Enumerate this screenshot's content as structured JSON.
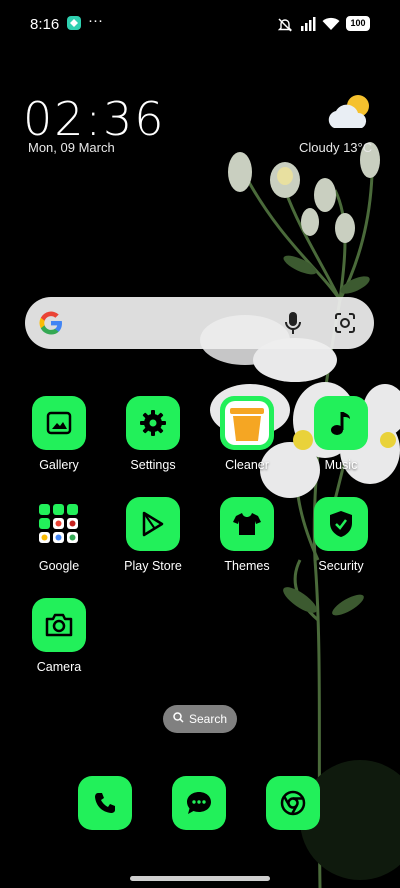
{
  "status_bar": {
    "time": "8:16",
    "overflow": "···",
    "battery": "100",
    "icons": [
      "app-notification-icon",
      "mute-icon",
      "signal-icon",
      "wifi-icon",
      "battery-icon"
    ]
  },
  "clock_widget": {
    "time": "02:36",
    "date": "Mon, 09 March",
    "weather": "Cloudy  13°C",
    "weather_icon": "cloudy-sun-icon"
  },
  "search": {
    "label": "Search",
    "icons": [
      "google-icon",
      "mic-icon",
      "lens-icon"
    ]
  },
  "apps": [
    {
      "label": "Gallery",
      "icon": "gallery-icon"
    },
    {
      "label": "Settings",
      "icon": "settings-icon"
    },
    {
      "label": "Cleaner",
      "icon": "cleaner-icon"
    },
    {
      "label": "Music",
      "icon": "music-icon"
    },
    {
      "label": "Google",
      "icon": "google-folder-icon"
    },
    {
      "label": "Play Store",
      "icon": "play-store-icon"
    },
    {
      "label": "Themes",
      "icon": "themes-icon"
    },
    {
      "label": "Security",
      "icon": "security-icon"
    },
    {
      "label": "Camera",
      "icon": "camera-icon"
    }
  ],
  "dock": [
    "phone-icon",
    "messages-icon",
    "chrome-icon"
  ],
  "colors": {
    "icon_tile": "#22f05a",
    "background": "#000000"
  }
}
